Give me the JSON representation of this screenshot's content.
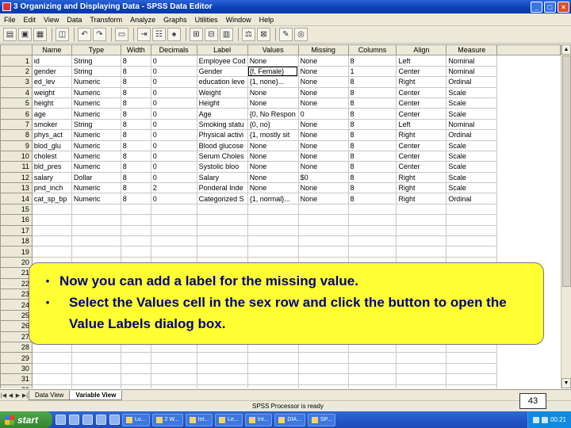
{
  "window": {
    "title": "3 Organizing and Displaying Data - SPSS Data Editor"
  },
  "menu": [
    "File",
    "Edit",
    "View",
    "Data",
    "Transform",
    "Analyze",
    "Graphs",
    "Utilities",
    "Window",
    "Help"
  ],
  "toolbar": [
    {
      "icon": "open-folder-icon",
      "glyph": "▤"
    },
    {
      "icon": "save-icon",
      "glyph": "▣"
    },
    {
      "icon": "print-icon",
      "glyph": "▦"
    },
    {
      "icon": "dialog-recall-icon",
      "glyph": "◫"
    },
    {
      "icon": "undo-icon",
      "glyph": "↶"
    },
    {
      "icon": "redo-icon",
      "glyph": "↷"
    },
    {
      "icon": "goto-chart-icon",
      "glyph": "▭"
    },
    {
      "icon": "goto-case-icon",
      "glyph": "⇥"
    },
    {
      "icon": "variables-icon",
      "glyph": "☷"
    },
    {
      "icon": "find-icon",
      "glyph": "♠"
    },
    {
      "icon": "insert-cases-icon",
      "glyph": "⊞"
    },
    {
      "icon": "insert-variable-icon",
      "glyph": "⊟"
    },
    {
      "icon": "split-file-icon",
      "glyph": "▥"
    },
    {
      "icon": "weight-cases-icon",
      "glyph": "⚖"
    },
    {
      "icon": "select-cases-icon",
      "glyph": "⊠"
    },
    {
      "icon": "value-labels-icon",
      "glyph": "✎"
    },
    {
      "icon": "use-sets-icon",
      "glyph": "◎"
    }
  ],
  "grid": {
    "columns": [
      "Name",
      "Type",
      "Width",
      "Decimals",
      "Label",
      "Values",
      "Missing",
      "Columns",
      "Align",
      "Measure"
    ],
    "rows": [
      [
        "id",
        "String",
        "8",
        "0",
        "Employee Cod",
        "None",
        "None",
        "8",
        "Left",
        "Nominal"
      ],
      [
        "gender",
        "String",
        "8",
        "0",
        "Gender",
        "{f, Female}",
        "None",
        "1",
        "Center",
        "Nominal"
      ],
      [
        "ed_lev",
        "Numeric",
        "8",
        "0",
        "education leve",
        "{1, none}...",
        "None",
        "8",
        "Right",
        "Ordinal"
      ],
      [
        "weight",
        "Numeric",
        "8",
        "0",
        "Weight",
        "None",
        "None",
        "8",
        "Center",
        "Scale"
      ],
      [
        "height",
        "Numeric",
        "8",
        "0",
        "Height",
        "None",
        "None",
        "8",
        "Center",
        "Scale"
      ],
      [
        "age",
        "Numeric",
        "8",
        "0",
        "Age",
        "{0, No Respon",
        "0",
        "8",
        "Center",
        "Scale"
      ],
      [
        "smoker",
        "String",
        "8",
        "0",
        "Smoking statu",
        "{0, no}",
        "None",
        "8",
        "Left",
        "Nominal"
      ],
      [
        "phys_act",
        "Numeric",
        "8",
        "0",
        "Physical activi",
        "{1, mostly sit",
        "None",
        "8",
        "Right",
        "Ordinal"
      ],
      [
        "blod_glu",
        "Numeric",
        "8",
        "0",
        "Blood glucose",
        "None",
        "None",
        "8",
        "Center",
        "Scale"
      ],
      [
        "cholest",
        "Numeric",
        "8",
        "0",
        "Serum Choles",
        "None",
        "None",
        "8",
        "Center",
        "Scale"
      ],
      [
        "bld_pres",
        "Numeric",
        "8",
        "0",
        "Systolic bloo",
        "None",
        "None",
        "8",
        "Center",
        "Scale"
      ],
      [
        "salary",
        "Dollar",
        "8",
        "0",
        "Salary",
        "None",
        "$0",
        "8",
        "Right",
        "Scale"
      ],
      [
        "pnd_inch",
        "Numeric",
        "8",
        "2",
        "Ponderal Inde",
        "None",
        "None",
        "8",
        "Right",
        "Scale"
      ],
      [
        "cat_sp_bp",
        "Numeric",
        "8",
        "0",
        "Categorized S",
        "{1, normal}...",
        "None",
        "8",
        "Right",
        "Ordinal"
      ]
    ],
    "row_count": 32
  },
  "tabs": [
    "Data View",
    "Variable View"
  ],
  "status": "SPSS Processor is ready",
  "page_number": "43",
  "callout": {
    "bullets": [
      "Now you can add a label for the missing value.",
      "Select the Values cell in the sex row and click the button to open the Value Labels dialog box."
    ]
  },
  "taskbar": {
    "start_label": "start",
    "tasks": [
      "Lo...",
      "2 W...",
      "Int...",
      "Le...",
      "Int...",
      "DIA...",
      "SP..."
    ],
    "clock": "00:21"
  }
}
